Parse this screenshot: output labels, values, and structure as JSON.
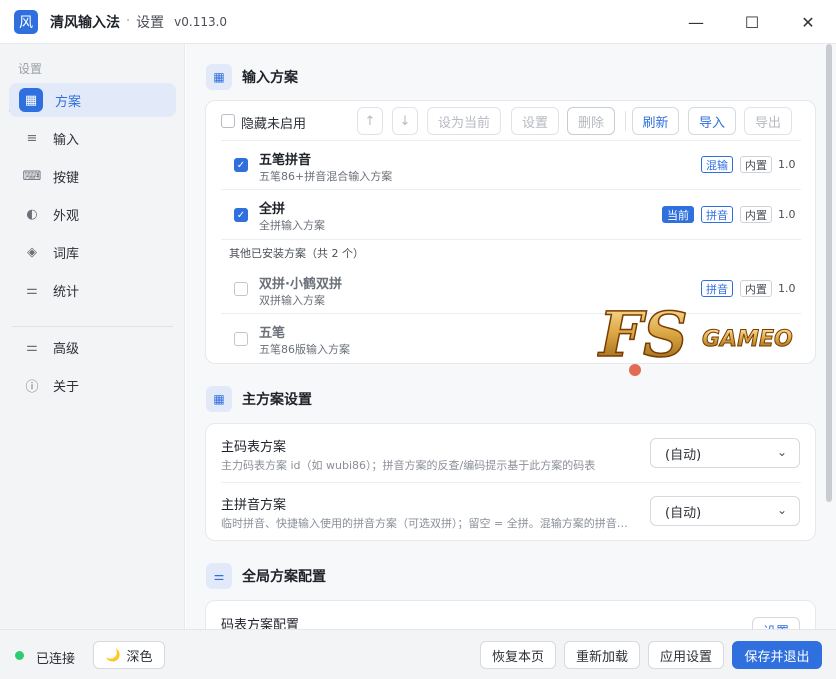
{
  "window": {
    "app_icon_char": "风",
    "app_name": "清风输入法",
    "separator": "·",
    "page": "设置",
    "version": "v0.113.0",
    "minimize": "—",
    "maximize": "☐",
    "close": "✕"
  },
  "sidebar": {
    "heading": "设置",
    "items": [
      {
        "label": "方案",
        "icon": "grid-icon",
        "glyph": "▦",
        "active": true
      },
      {
        "label": "输入",
        "icon": "lines-icon",
        "glyph": "≡"
      },
      {
        "label": "按键",
        "icon": "keyboard-icon",
        "glyph": "⌨"
      },
      {
        "label": "外观",
        "icon": "contrast-icon",
        "glyph": "◐"
      },
      {
        "label": "词库",
        "icon": "layers-icon",
        "glyph": "◈"
      },
      {
        "label": "统计",
        "icon": "sliders-icon",
        "glyph": "⚌"
      },
      {
        "label": "高级",
        "icon": "sliders-icon",
        "glyph": "⚌"
      },
      {
        "label": "关于",
        "icon": "info-icon",
        "glyph": "ⓘ"
      }
    ]
  },
  "footer": {
    "status": "已连接",
    "theme_icon": "🌙",
    "theme_label": "深色",
    "restore": "恢复本页",
    "reload": "重新加载",
    "apply": "应用设置",
    "save_exit": "保存并退出",
    "status_color": "#2ecc71"
  },
  "schemes": {
    "title": "输入方案",
    "toolbar": {
      "hide_disabled": "隐藏未启用",
      "up": "↑",
      "down": "↓",
      "set_current": "设为当前",
      "settings": "设置",
      "delete": "删除",
      "refresh": "刷新",
      "import": "导入",
      "export": "导出"
    },
    "installed": [
      {
        "name": "五笔拼音",
        "desc": "五笔86+拼音混合输入方案",
        "tags": [
          "混输"
        ],
        "builtin": "内置",
        "version": "1.0",
        "checked": true
      },
      {
        "name": "全拼",
        "desc": "全拼输入方案",
        "current": "当前",
        "tags": [
          "拼音"
        ],
        "builtin": "内置",
        "version": "1.0",
        "checked": true
      }
    ],
    "other_label": "其他已安装方案（共 2 个）",
    "others": [
      {
        "name": "双拼·小鹤双拼",
        "desc": "双拼输入方案",
        "tags": [
          "拼音"
        ],
        "builtin": "内置",
        "version": "1.0",
        "checked": false
      },
      {
        "name": "五笔",
        "desc": "五笔86版输入方案",
        "checked": false
      }
    ]
  },
  "main_settings": {
    "title": "主方案设置",
    "rows": [
      {
        "title": "主码表方案",
        "desc": "主力码表方案 id（如 wubi86）；拼音方案的反查/编码提示基于此方案的码表",
        "value": "(自动)"
      },
      {
        "title": "主拼音方案",
        "desc": "临时拼音、快捷输入使用的拼音方案（可选双拼）；留空 = 全拼。混输方案的拼音…",
        "value": "(自动)"
      }
    ]
  },
  "global_config": {
    "title": "全局方案配置",
    "row_title": "码表方案配置",
    "button": "设置"
  },
  "watermark": {
    "text": "GAMEO",
    "mark": "FS"
  },
  "colors": {
    "accent": "#2f6fde",
    "sidebar_bg": "#f3f4f6",
    "main_bg": "#f7f8fa"
  }
}
